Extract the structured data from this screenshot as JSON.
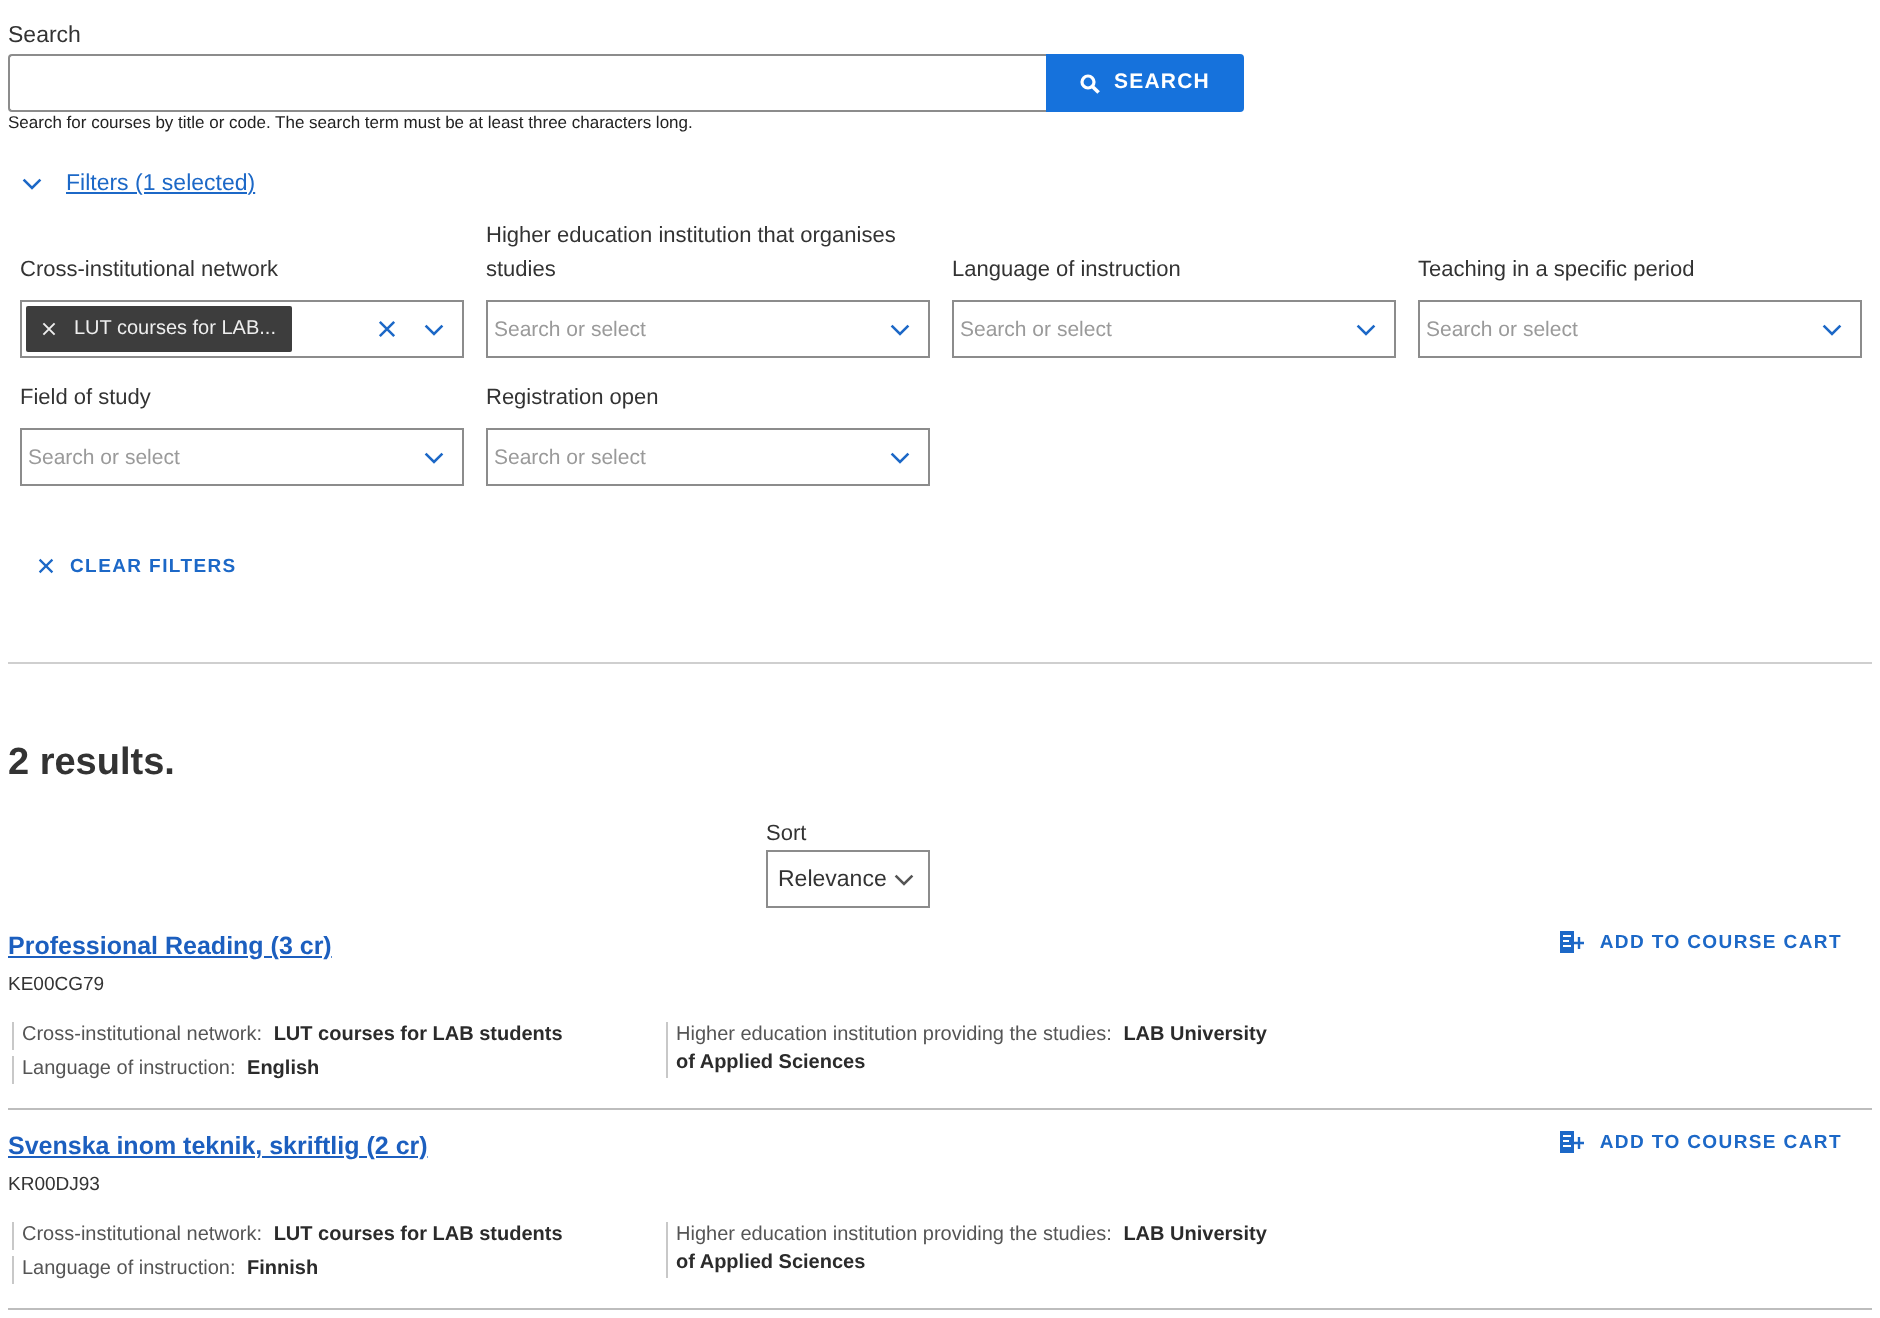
{
  "search": {
    "label": "Search",
    "button": "SEARCH",
    "hint": "Search for courses by title or code. The search term must be at least three characters long."
  },
  "filters": {
    "toggle_label": "Filters (1 selected)",
    "expanded": true,
    "fields": [
      {
        "label": "Cross-institutional network",
        "selected_values": [
          "LUT courses for LAB..."
        ]
      },
      {
        "label": "Higher education institution that organises studies",
        "placeholder": "Search or select"
      },
      {
        "label": "Language of instruction",
        "placeholder": "Search or select"
      },
      {
        "label": "Teaching in a specific period",
        "placeholder": "Search or select"
      },
      {
        "label": "Field of study",
        "placeholder": "Search or select"
      },
      {
        "label": "Registration open",
        "placeholder": "Search or select"
      }
    ],
    "clear_button": "CLEAR FILTERS"
  },
  "results": {
    "heading": "2 results.",
    "sort": {
      "label": "Sort",
      "value": "Relevance"
    },
    "items": [
      {
        "title": "Professional Reading (3 cr)",
        "code": "KE00CG79",
        "action": "ADD TO COURSE CART",
        "detail_columns": [
          {
            "details": [
              {
                "label": "Cross-institutional network:",
                "value": "LUT courses for LAB students"
              },
              {
                "label": "Language of instruction:",
                "value": "English"
              }
            ]
          },
          {
            "details": [
              {
                "label": "Higher education institution providing the studies:",
                "value": "LAB University of Applied Sciences"
              }
            ]
          }
        ]
      },
      {
        "title": "Svenska inom teknik, skriftlig (2 cr)",
        "code": "KR00DJ93",
        "action": "ADD TO COURSE CART",
        "detail_columns": [
          {
            "details": [
              {
                "label": "Cross-institutional network:",
                "value": "LUT courses for LAB students"
              },
              {
                "label": "Language of instruction:",
                "value": "Finnish"
              }
            ]
          },
          {
            "details": [
              {
                "label": "Higher education institution providing the studies:",
                "value": "LAB University of Applied Sciences"
              }
            ]
          }
        ]
      }
    ]
  }
}
